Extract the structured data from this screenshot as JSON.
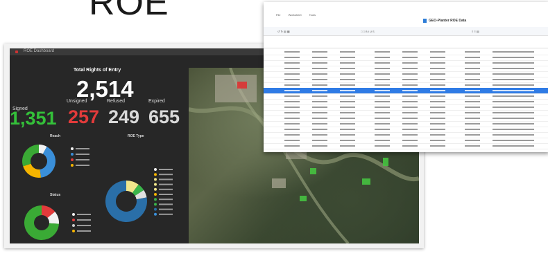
{
  "header": {
    "title_partial": "ROE"
  },
  "dashboard": {
    "topbar_text": "ROE Dashboard",
    "kpi_title": "Total Rights of Entry",
    "total": "2,514",
    "stats": [
      {
        "label": "Signed",
        "value": "1,351",
        "color": "#34c13a"
      },
      {
        "label": "Unsigned",
        "value": "257",
        "color": "#e23b3b"
      },
      {
        "label": "Refused",
        "value": "249",
        "color": "#d9d9d9"
      },
      {
        "label": "Expired",
        "value": "655",
        "color": "#d9d9d9"
      }
    ],
    "reach": {
      "label": "Reach",
      "segments": [
        {
          "color": "#f2f2f2",
          "value": 8
        },
        {
          "color": "#3a8fd9",
          "value": 40
        },
        {
          "color": "#f5b400",
          "value": 22
        },
        {
          "color": "#3aaa35",
          "value": 30
        }
      ],
      "legend": [
        {
          "color": "#f2f2f2"
        },
        {
          "color": "#3a8fd9"
        },
        {
          "color": "#e23b3b"
        },
        {
          "color": "#f5b400"
        }
      ]
    },
    "status": {
      "label": "Status",
      "segments": [
        {
          "color": "#e23b3b",
          "value": 14
        },
        {
          "color": "#f2f2f2",
          "value": 12
        },
        {
          "color": "#3aaa35",
          "value": 74
        }
      ],
      "legend": [
        {
          "color": "#f2f2f2"
        },
        {
          "color": "#e23b3b"
        },
        {
          "color": "#cccccc"
        },
        {
          "color": "#f5b400"
        }
      ]
    },
    "roe_type": {
      "label": "ROE Type",
      "segments": [
        {
          "color": "#f0e68c",
          "value": 10
        },
        {
          "color": "#3ab54a",
          "value": 6
        },
        {
          "color": "#e0e0e0",
          "value": 6
        },
        {
          "color": "#2a6fa8",
          "value": 78
        }
      ],
      "legend": [
        {
          "color": "#f2f2f2"
        },
        {
          "color": "#f5b400"
        },
        {
          "color": "#f0e68c"
        },
        {
          "color": "#f0e68c"
        },
        {
          "color": "#f0e68c"
        },
        {
          "color": "#f5b400"
        },
        {
          "color": "#3ab54a"
        },
        {
          "color": "#3ab54a"
        },
        {
          "color": "#2a6fa8"
        },
        {
          "color": "#3a8fd9"
        }
      ]
    }
  },
  "sheet": {
    "doc_title": "GEO-Planter ROE Data",
    "menu": [
      "File",
      "Worksheet",
      "Tools"
    ],
    "selected_row": 7,
    "row_count": 18
  }
}
